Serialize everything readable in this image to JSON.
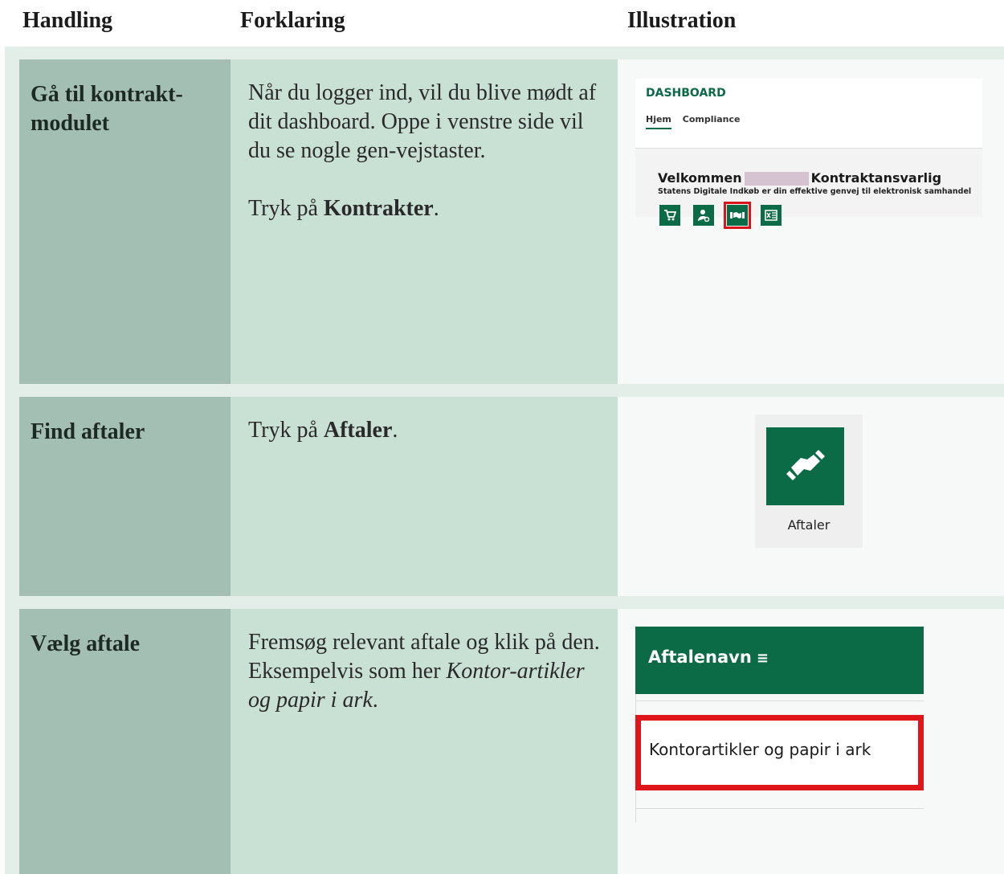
{
  "header": {
    "col1": "Handling",
    "col2": "Forklaring",
    "col3": "Illustration"
  },
  "rows": [
    {
      "action": "Gå til kontrakt-modulet",
      "action_line1": "Gå til kontrakt-",
      "action_line2": "modulet",
      "expl_p1": "Når du logger ind, vil du blive mødt af dit dashboard. Oppe i venstre side vil du se nogle gen-vejstaster.",
      "expl_p2_pre": "Tryk på ",
      "expl_p2_bold": "Kontrakter",
      "expl_p2_post": "."
    },
    {
      "action": "Find aftaler",
      "expl_pre": "Tryk på ",
      "expl_bold": "Aftaler",
      "expl_post": "."
    },
    {
      "action": "Vælg aftale",
      "expl_pre": "Fremsøg relevant aftale og klik på den. Eksempelvis som her ",
      "expl_italic": "Kontor-artikler og papir i ark",
      "expl_post": "."
    }
  ],
  "dashboard": {
    "title": "DASHBOARD",
    "tabs": [
      "Hjem",
      "Compliance"
    ],
    "welcome": "Velkommen",
    "role": "Kontraktansvarlig",
    "subtitle": "Statens Digitale Indkøb er din effektive genvej til elektronisk samhandel",
    "icons": [
      "cart-icon",
      "user-settings-icon",
      "handshake-icon",
      "excel-icon"
    ],
    "highlighted_icon": "handshake-icon",
    "accent_color": "#0b6b46",
    "highlight_color": "#d9151b"
  },
  "tile": {
    "label": "Aftaler",
    "icon": "handshake-icon"
  },
  "agreement_list": {
    "header": "Aftalenavn",
    "item": "Kontorartikler og papir i ark"
  }
}
